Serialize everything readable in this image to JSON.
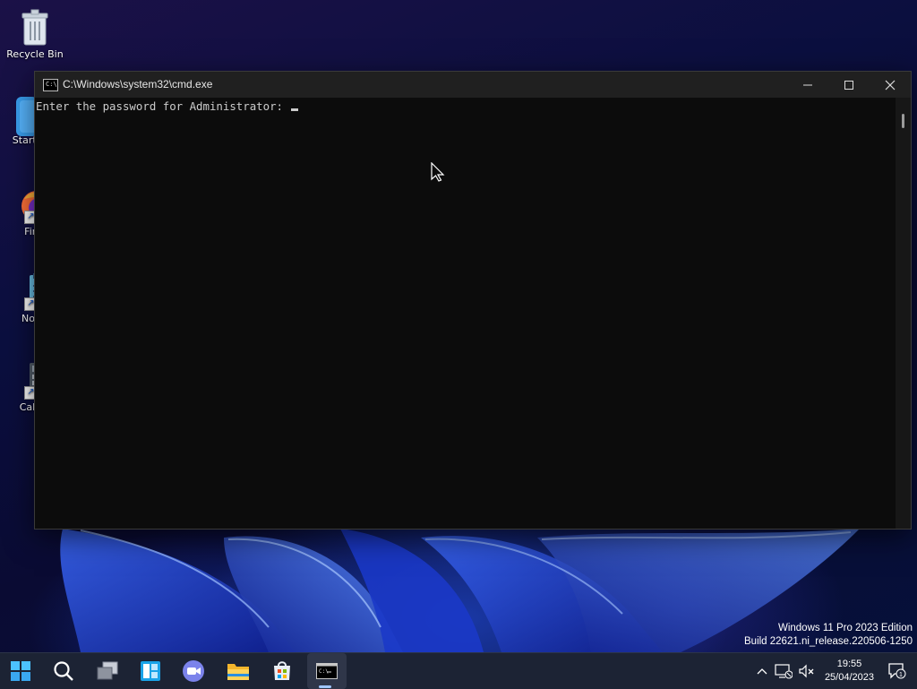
{
  "desktop": {
    "icons": [
      {
        "label": "Recycle Bin"
      },
      {
        "label": "StartA"
      },
      {
        "label": "Fire"
      },
      {
        "label": "Note"
      },
      {
        "label": "Calcu"
      }
    ],
    "watermark": {
      "line1": "Windows 11 Pro 2023 Edition",
      "line2": "Build 22621.ni_release.220506-1250"
    }
  },
  "window": {
    "title": "C:\\Windows\\system32\\cmd.exe",
    "icon_text": "C:\\",
    "console_prompt": "Enter the password for Administrator: "
  },
  "taskbar": {
    "cmd_icon_text": "C:\\",
    "clock": {
      "time": "19:55",
      "date": "25/04/2023"
    },
    "notification_count": "1"
  },
  "colors": {
    "taskbar_bg": "#1c2334",
    "console_bg": "#0c0c0c",
    "console_fg": "#cccccc",
    "titlebar_bg": "#202020"
  }
}
